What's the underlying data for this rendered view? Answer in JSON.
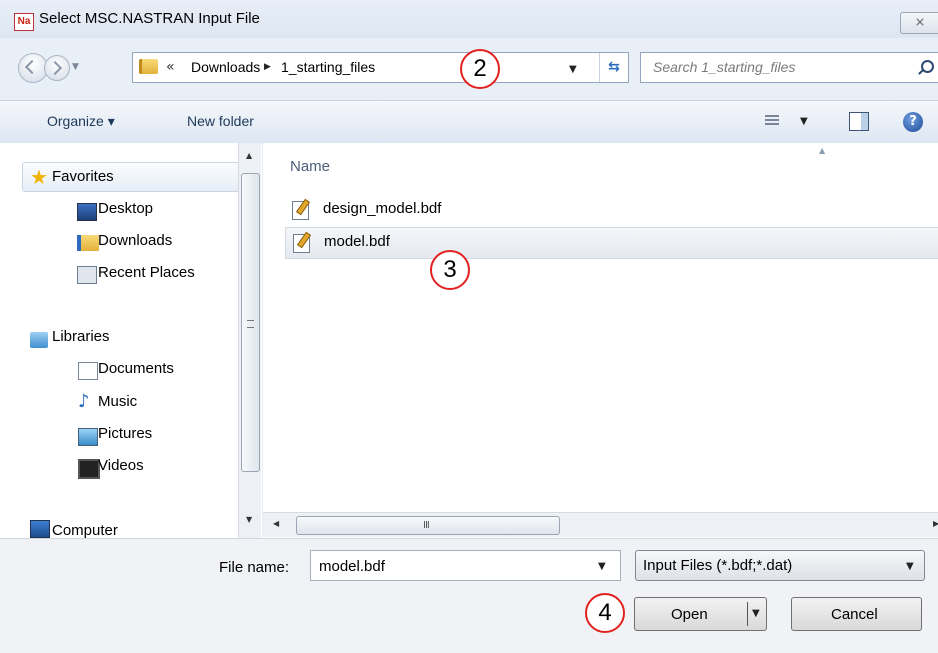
{
  "window": {
    "title": "Select MSC.NASTRAN Input File",
    "app_icon_text": "Na",
    "close_glyph": "⨯"
  },
  "address_bar": {
    "prefix": "«",
    "crumbs": [
      "Downloads",
      "1_starting_files"
    ],
    "search_placeholder": "Search 1_starting_files"
  },
  "toolbar": {
    "organize": "Organize ▾",
    "new_folder": "New folder"
  },
  "nav_pane": {
    "favorites": "Favorites",
    "desktop": "Desktop",
    "downloads": "Downloads",
    "recent_places": "Recent Places",
    "libraries": "Libraries",
    "documents": "Documents",
    "music": "Music",
    "pictures": "Pictures",
    "videos": "Videos",
    "computer": "Computer"
  },
  "file_list": {
    "column_name": "Name",
    "files": [
      "design_model.bdf",
      "model.bdf"
    ],
    "selected_file": "model.bdf"
  },
  "hscroll_grip": "III",
  "bottom": {
    "file_name_label": "File name:",
    "file_name_value": "model.bdf",
    "filter": "Input Files (*.bdf;*.dat)",
    "open_label": "Open",
    "cancel_label": "Cancel"
  },
  "callouts": {
    "two": "2",
    "three": "3",
    "four": "4"
  },
  "colors": {
    "callout_ring": "#e32020",
    "selection": "#e5e9ef",
    "chrome": "#e9eff7"
  }
}
